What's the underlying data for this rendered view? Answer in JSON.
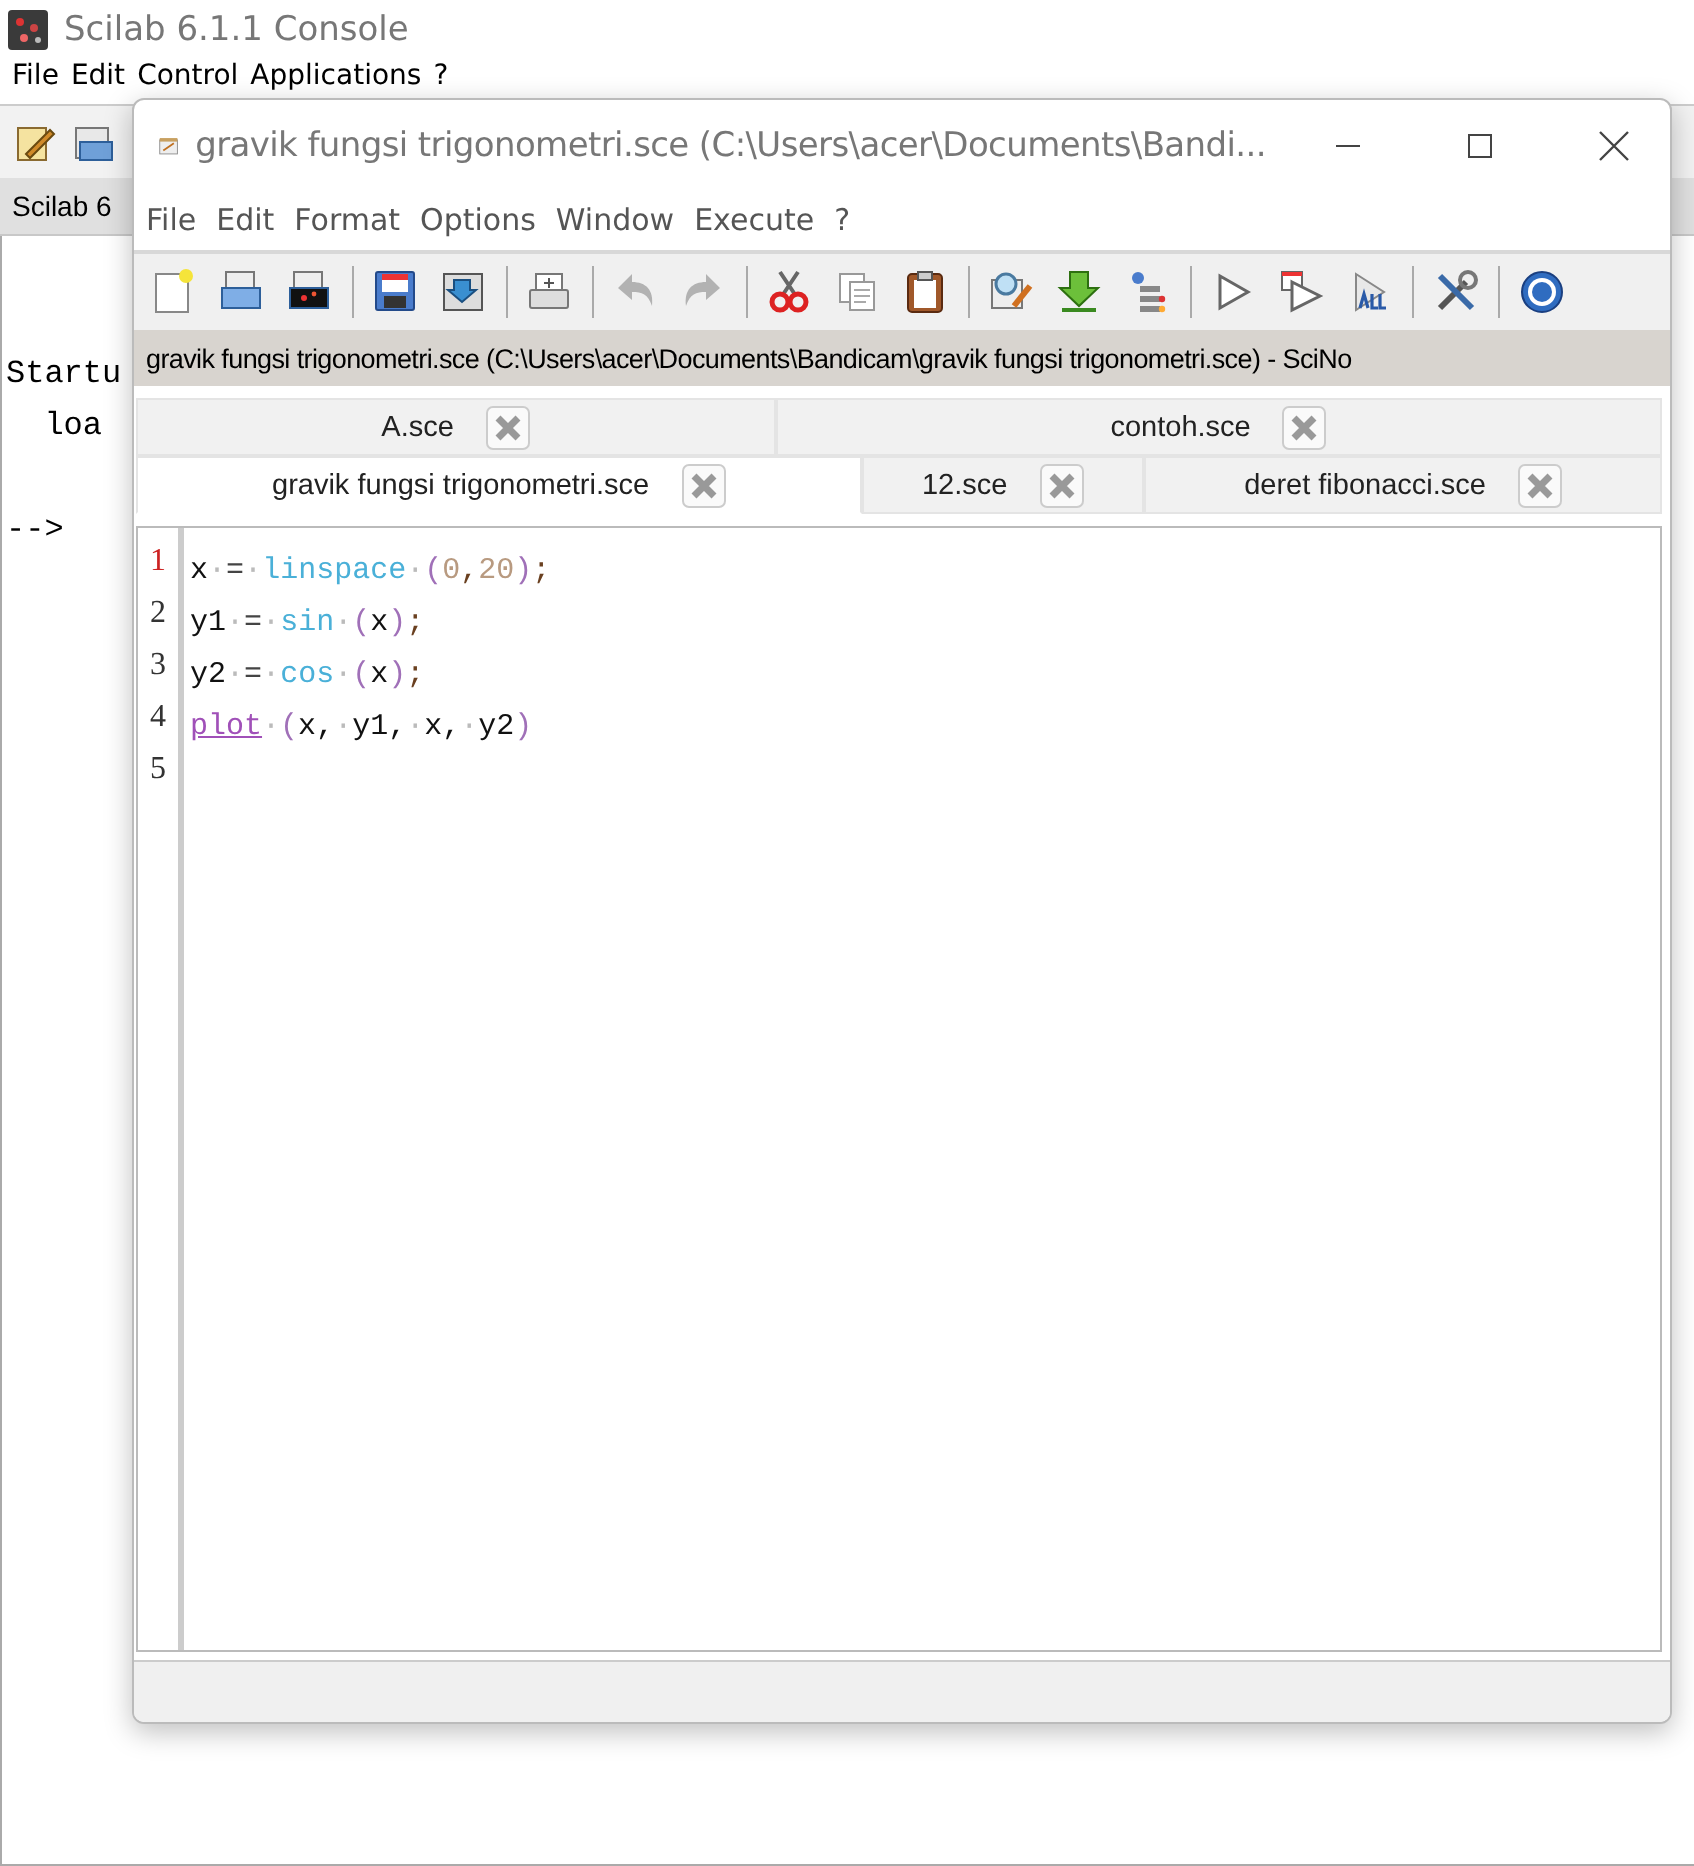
{
  "console": {
    "title": "Scilab 6.1.1 Console",
    "menu": [
      "File",
      "Edit",
      "Control",
      "Applications",
      "?"
    ],
    "tab": "Scilab 6",
    "lines": [
      "Startu",
      "  loa"
    ],
    "prompt": "-->"
  },
  "editor": {
    "title": "gravik fungsi trigonometri.sce (C:\\Users\\acer\\Documents\\Bandi...",
    "menu": [
      "File",
      "Edit",
      "Format",
      "Options",
      "Window",
      "Execute",
      "?"
    ],
    "toolbar": [
      [
        {
          "disabled": false
        },
        {
          "disabled": false
        },
        {
          "disabled": false
        }
      ],
      [
        {
          "disabled": false
        },
        {
          "disabled": false
        }
      ],
      [
        {
          "disabled": false
        }
      ],
      [
        {
          "disabled": true
        },
        {
          "disabled": true
        }
      ],
      [
        {
          "disabled": false
        },
        {
          "disabled": false
        },
        {
          "disabled": false
        }
      ],
      [
        {
          "disabled": false
        },
        {
          "disabled": false
        },
        {
          "disabled": false
        }
      ],
      [
        {
          "disabled": false
        },
        {
          "disabled": false
        },
        {
          "disabled": false
        }
      ],
      [
        {
          "disabled": false
        }
      ],
      [
        {
          "disabled": false
        }
      ]
    ],
    "path": "gravik fungsi trigonometri.sce (C:\\Users\\acer\\Documents\\Bandicam\\gravik fungsi trigonometri.sce) - SciNo",
    "tab_rows": [
      [
        {
          "label": "A.sce",
          "selected": false
        },
        {
          "label": "contoh.sce",
          "selected": false
        }
      ],
      [
        {
          "label": "gravik fungsi trigonometri.sce",
          "selected": true
        },
        {
          "label": "12.sce",
          "selected": false
        },
        {
          "label": "deret fibonacci.sce",
          "selected": false
        }
      ]
    ],
    "lines": [
      {
        "number": "1",
        "current": true,
        "tokens": [
          {
            "kind": "var",
            "text": "x"
          },
          {
            "kind": "space",
            "text": "·"
          },
          {
            "kind": "op",
            "text": "="
          },
          {
            "kind": "space",
            "text": "·"
          },
          {
            "kind": "func",
            "text": "linspace"
          },
          {
            "kind": "space",
            "text": "·"
          },
          {
            "kind": "paren",
            "text": "("
          },
          {
            "kind": "num",
            "text": "0"
          },
          {
            "kind": "punct",
            "text": ","
          },
          {
            "kind": "num",
            "text": "20"
          },
          {
            "kind": "paren",
            "text": ")"
          },
          {
            "kind": "punct",
            "text": ";"
          }
        ]
      },
      {
        "number": "2",
        "current": false,
        "tokens": [
          {
            "kind": "var",
            "text": "y1"
          },
          {
            "kind": "space",
            "text": "·"
          },
          {
            "kind": "op",
            "text": "="
          },
          {
            "kind": "space",
            "text": "·"
          },
          {
            "kind": "func",
            "text": "sin"
          },
          {
            "kind": "space",
            "text": "·"
          },
          {
            "kind": "paren",
            "text": "("
          },
          {
            "kind": "var",
            "text": "x"
          },
          {
            "kind": "paren",
            "text": ")"
          },
          {
            "kind": "punct",
            "text": ";"
          }
        ]
      },
      {
        "number": "3",
        "current": false,
        "tokens": [
          {
            "kind": "var",
            "text": "y2"
          },
          {
            "kind": "space",
            "text": "·"
          },
          {
            "kind": "op",
            "text": "="
          },
          {
            "kind": "space",
            "text": "·"
          },
          {
            "kind": "func",
            "text": "cos"
          },
          {
            "kind": "space",
            "text": "·"
          },
          {
            "kind": "paren",
            "text": "("
          },
          {
            "kind": "var",
            "text": "x"
          },
          {
            "kind": "paren",
            "text": ")"
          },
          {
            "kind": "punct",
            "text": ";"
          }
        ]
      },
      {
        "number": "4",
        "current": false,
        "tokens": [
          {
            "kind": "macro",
            "text": "plot"
          },
          {
            "kind": "space",
            "text": "·"
          },
          {
            "kind": "paren",
            "text": "("
          },
          {
            "kind": "var",
            "text": "x,"
          },
          {
            "kind": "space",
            "text": "·"
          },
          {
            "kind": "var",
            "text": "y1,"
          },
          {
            "kind": "space",
            "text": "·"
          },
          {
            "kind": "var",
            "text": "x,"
          },
          {
            "kind": "space",
            "text": "·"
          },
          {
            "kind": "var",
            "text": "y2"
          },
          {
            "kind": "paren",
            "text": ")"
          }
        ]
      },
      {
        "number": "5",
        "current": false
      }
    ]
  }
}
